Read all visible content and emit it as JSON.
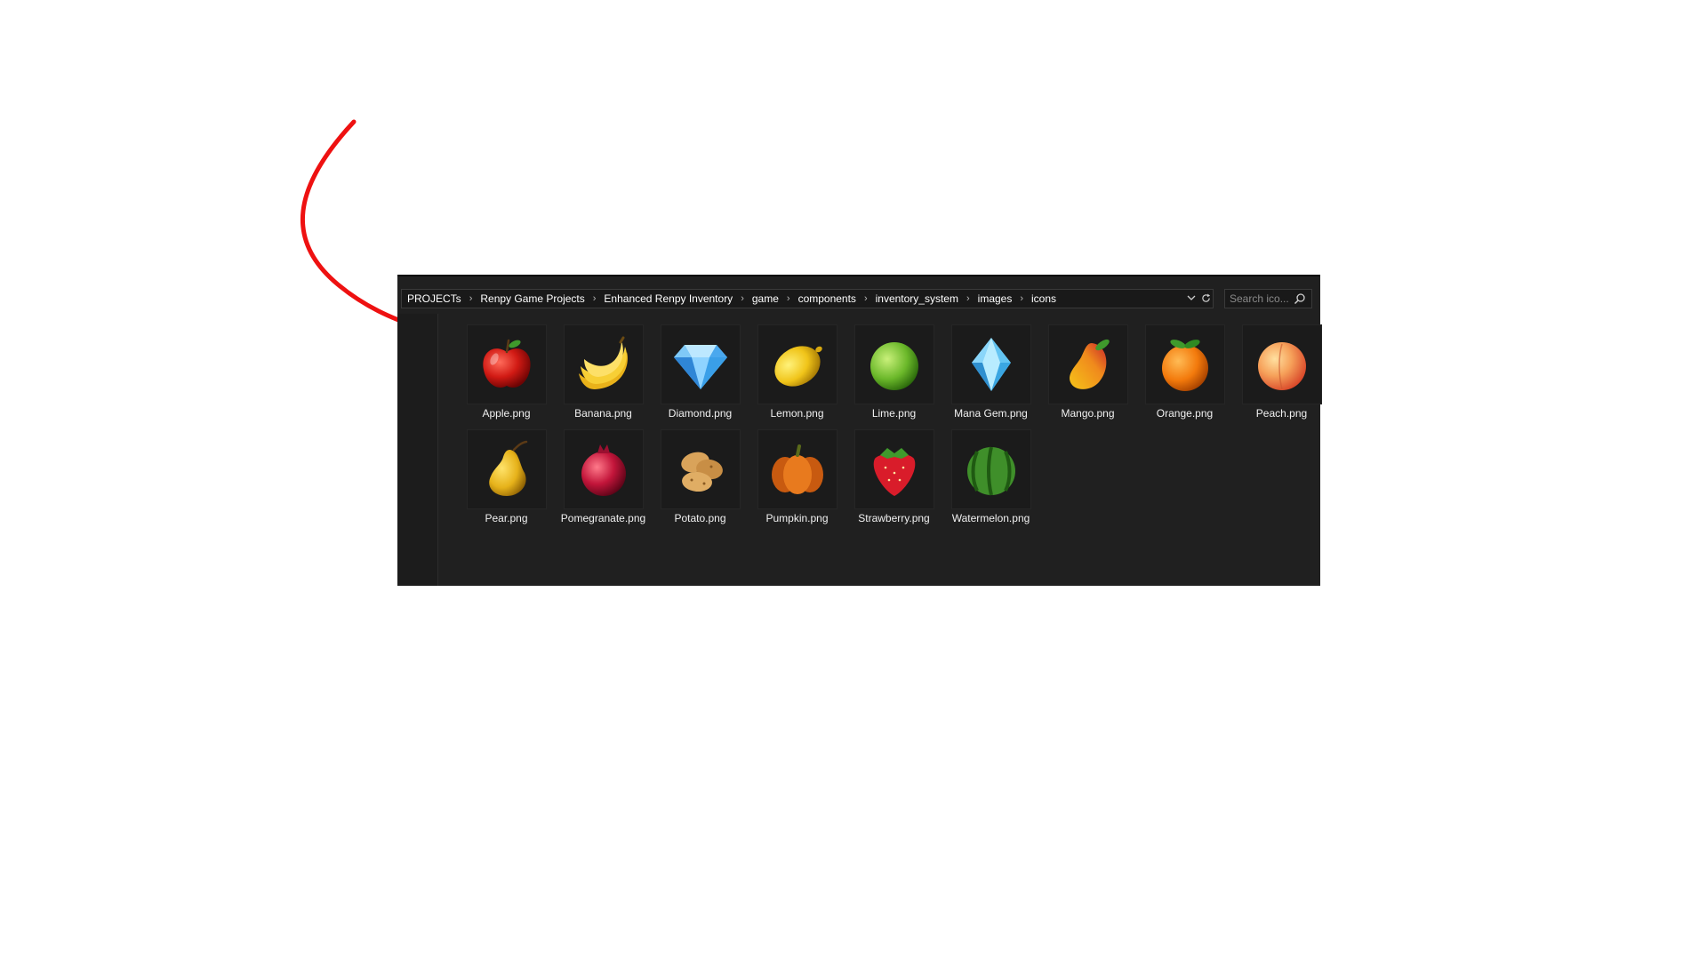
{
  "explorer": {
    "breadcrumb": [
      "PROJECTs",
      "Renpy Game Projects",
      "Enhanced Renpy Inventory",
      "game",
      "components",
      "inventory_system",
      "images",
      "icons"
    ],
    "address_icons": {
      "dropdown": "chevron-down-icon",
      "refresh": "refresh-icon"
    },
    "search": {
      "placeholder": "Search ico...",
      "value": "",
      "icon": "search-icon"
    },
    "files": [
      {
        "name": "Apple.png",
        "icon": "apple-icon"
      },
      {
        "name": "Banana.png",
        "icon": "banana-icon"
      },
      {
        "name": "Diamond.png",
        "icon": "diamond-icon"
      },
      {
        "name": "Lemon.png",
        "icon": "lemon-icon"
      },
      {
        "name": "Lime.png",
        "icon": "lime-icon"
      },
      {
        "name": "Mana Gem.png",
        "icon": "mana-gem-icon"
      },
      {
        "name": "Mango.png",
        "icon": "mango-icon"
      },
      {
        "name": "Orange.png",
        "icon": "orange-icon"
      },
      {
        "name": "Peach.png",
        "icon": "peach-icon"
      },
      {
        "name": "Pear.png",
        "icon": "pear-icon"
      },
      {
        "name": "Pomegranate.png",
        "icon": "pomegranate-icon"
      },
      {
        "name": "Potato.png",
        "icon": "potato-icon"
      },
      {
        "name": "Pumpkin.png",
        "icon": "pumpkin-icon"
      },
      {
        "name": "Strawberry.png",
        "icon": "strawberry-icon"
      },
      {
        "name": "Watermelon.png",
        "icon": "watermelon-icon"
      }
    ]
  },
  "annotation": {
    "type": "arrow",
    "color": "#ee1111",
    "points_to": "Apple.png"
  }
}
